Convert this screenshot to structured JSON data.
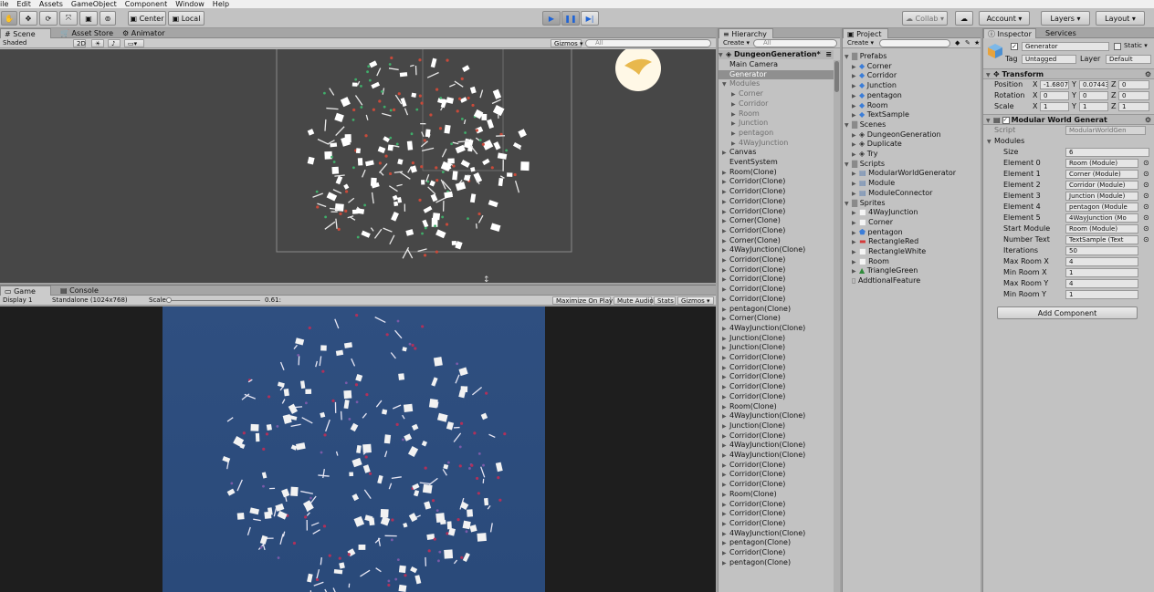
{
  "menu": [
    "ile",
    "Edit",
    "Assets",
    "GameObject",
    "Component",
    "Window",
    "Help"
  ],
  "toolbar": {
    "pivot_label": "Center",
    "space_label": "Local",
    "collab_label": "Collab ▾",
    "account_label": "Account ▾",
    "layers_label": "Layers ▾",
    "layout_label": "Layout ▾"
  },
  "scene_panel": {
    "tabs": [
      "Scene",
      "Asset Store",
      "Animator"
    ],
    "shading": "Shaded",
    "mode_2d": "2D",
    "gizmos": "Gizmos ▾",
    "search_placeholder": "All"
  },
  "game_panel": {
    "tabs": [
      "Game",
      "Console"
    ],
    "display": "Display 1",
    "resolution": "Standalone (1024x768)",
    "scale_label": "Scale",
    "scale_value": "0.61:",
    "scale_fraction": 0.0,
    "maximize": "Maximize On Play",
    "mute": "Mute Audio",
    "stats": "Stats",
    "gizmos": "Gizmos ▾"
  },
  "hierarchy": {
    "tab": "Hierarchy",
    "create": "Create ▾",
    "search_placeholder": "All",
    "scene_name": "DungeonGeneration*",
    "items": [
      {
        "label": "Main Camera",
        "indent": 1,
        "selected": false,
        "dim": false,
        "arrow": ""
      },
      {
        "label": "Generator",
        "indent": 1,
        "selected": true,
        "dim": false,
        "arrow": ""
      },
      {
        "label": "Modules",
        "indent": 1,
        "selected": false,
        "dim": true,
        "arrow": "▼"
      },
      {
        "label": "Corner",
        "indent": 2,
        "selected": false,
        "dim": true,
        "arrow": "▶"
      },
      {
        "label": "Corridor",
        "indent": 2,
        "selected": false,
        "dim": true,
        "arrow": "▶"
      },
      {
        "label": "Room",
        "indent": 2,
        "selected": false,
        "dim": true,
        "arrow": "▶"
      },
      {
        "label": "Junction",
        "indent": 2,
        "selected": false,
        "dim": true,
        "arrow": "▶"
      },
      {
        "label": "pentagon",
        "indent": 2,
        "selected": false,
        "dim": true,
        "arrow": "▶"
      },
      {
        "label": "4WayJunction",
        "indent": 2,
        "selected": false,
        "dim": true,
        "arrow": "▶"
      },
      {
        "label": "Canvas",
        "indent": 1,
        "selected": false,
        "dim": false,
        "arrow": "▶"
      },
      {
        "label": "EventSystem",
        "indent": 1,
        "selected": false,
        "dim": false,
        "arrow": ""
      },
      {
        "label": "Room(Clone)",
        "indent": 1,
        "selected": false,
        "dim": false,
        "arrow": "▶"
      },
      {
        "label": "Corridor(Clone)",
        "indent": 1,
        "selected": false,
        "dim": false,
        "arrow": "▶"
      },
      {
        "label": "Corridor(Clone)",
        "indent": 1,
        "selected": false,
        "dim": false,
        "arrow": "▶"
      },
      {
        "label": "Corridor(Clone)",
        "indent": 1,
        "selected": false,
        "dim": false,
        "arrow": "▶"
      },
      {
        "label": "Corridor(Clone)",
        "indent": 1,
        "selected": false,
        "dim": false,
        "arrow": "▶"
      },
      {
        "label": "Corner(Clone)",
        "indent": 1,
        "selected": false,
        "dim": false,
        "arrow": "▶"
      },
      {
        "label": "Corridor(Clone)",
        "indent": 1,
        "selected": false,
        "dim": false,
        "arrow": "▶"
      },
      {
        "label": "Corner(Clone)",
        "indent": 1,
        "selected": false,
        "dim": false,
        "arrow": "▶"
      },
      {
        "label": "4WayJunction(Clone)",
        "indent": 1,
        "selected": false,
        "dim": false,
        "arrow": "▶"
      },
      {
        "label": "Corridor(Clone)",
        "indent": 1,
        "selected": false,
        "dim": false,
        "arrow": "▶"
      },
      {
        "label": "Corridor(Clone)",
        "indent": 1,
        "selected": false,
        "dim": false,
        "arrow": "▶"
      },
      {
        "label": "Corridor(Clone)",
        "indent": 1,
        "selected": false,
        "dim": false,
        "arrow": "▶"
      },
      {
        "label": "Corridor(Clone)",
        "indent": 1,
        "selected": false,
        "dim": false,
        "arrow": "▶"
      },
      {
        "label": "Corridor(Clone)",
        "indent": 1,
        "selected": false,
        "dim": false,
        "arrow": "▶"
      },
      {
        "label": "pentagon(Clone)",
        "indent": 1,
        "selected": false,
        "dim": false,
        "arrow": "▶"
      },
      {
        "label": "Corner(Clone)",
        "indent": 1,
        "selected": false,
        "dim": false,
        "arrow": "▶"
      },
      {
        "label": "4WayJunction(Clone)",
        "indent": 1,
        "selected": false,
        "dim": false,
        "arrow": "▶"
      },
      {
        "label": "Junction(Clone)",
        "indent": 1,
        "selected": false,
        "dim": false,
        "arrow": "▶"
      },
      {
        "label": "Junction(Clone)",
        "indent": 1,
        "selected": false,
        "dim": false,
        "arrow": "▶"
      },
      {
        "label": "Corridor(Clone)",
        "indent": 1,
        "selected": false,
        "dim": false,
        "arrow": "▶"
      },
      {
        "label": "Corridor(Clone)",
        "indent": 1,
        "selected": false,
        "dim": false,
        "arrow": "▶"
      },
      {
        "label": "Corridor(Clone)",
        "indent": 1,
        "selected": false,
        "dim": false,
        "arrow": "▶"
      },
      {
        "label": "Corridor(Clone)",
        "indent": 1,
        "selected": false,
        "dim": false,
        "arrow": "▶"
      },
      {
        "label": "Corridor(Clone)",
        "indent": 1,
        "selected": false,
        "dim": false,
        "arrow": "▶"
      },
      {
        "label": "Room(Clone)",
        "indent": 1,
        "selected": false,
        "dim": false,
        "arrow": "▶"
      },
      {
        "label": "4WayJunction(Clone)",
        "indent": 1,
        "selected": false,
        "dim": false,
        "arrow": "▶"
      },
      {
        "label": "Junction(Clone)",
        "indent": 1,
        "selected": false,
        "dim": false,
        "arrow": "▶"
      },
      {
        "label": "Corridor(Clone)",
        "indent": 1,
        "selected": false,
        "dim": false,
        "arrow": "▶"
      },
      {
        "label": "4WayJunction(Clone)",
        "indent": 1,
        "selected": false,
        "dim": false,
        "arrow": "▶"
      },
      {
        "label": "4WayJunction(Clone)",
        "indent": 1,
        "selected": false,
        "dim": false,
        "arrow": "▶"
      },
      {
        "label": "Corridor(Clone)",
        "indent": 1,
        "selected": false,
        "dim": false,
        "arrow": "▶"
      },
      {
        "label": "Corridor(Clone)",
        "indent": 1,
        "selected": false,
        "dim": false,
        "arrow": "▶"
      },
      {
        "label": "Corridor(Clone)",
        "indent": 1,
        "selected": false,
        "dim": false,
        "arrow": "▶"
      },
      {
        "label": "Room(Clone)",
        "indent": 1,
        "selected": false,
        "dim": false,
        "arrow": "▶"
      },
      {
        "label": "Corridor(Clone)",
        "indent": 1,
        "selected": false,
        "dim": false,
        "arrow": "▶"
      },
      {
        "label": "Corridor(Clone)",
        "indent": 1,
        "selected": false,
        "dim": false,
        "arrow": "▶"
      },
      {
        "label": "Corridor(Clone)",
        "indent": 1,
        "selected": false,
        "dim": false,
        "arrow": "▶"
      },
      {
        "label": "4WayJunction(Clone)",
        "indent": 1,
        "selected": false,
        "dim": false,
        "arrow": "▶"
      },
      {
        "label": "pentagon(Clone)",
        "indent": 1,
        "selected": false,
        "dim": false,
        "arrow": "▶"
      },
      {
        "label": "Corridor(Clone)",
        "indent": 1,
        "selected": false,
        "dim": false,
        "arrow": "▶"
      },
      {
        "label": "pentagon(Clone)",
        "indent": 1,
        "selected": false,
        "dim": false,
        "arrow": "▶"
      }
    ]
  },
  "project": {
    "tab": "Project",
    "create": "Create ▾",
    "items": [
      {
        "label": "Prefabs",
        "indent": 0,
        "kind": "folder"
      },
      {
        "label": "Corner",
        "indent": 1,
        "kind": "prefab"
      },
      {
        "label": "Corridor",
        "indent": 1,
        "kind": "prefab"
      },
      {
        "label": "Junction",
        "indent": 1,
        "kind": "prefab"
      },
      {
        "label": "pentagon",
        "indent": 1,
        "kind": "prefab"
      },
      {
        "label": "Room",
        "indent": 1,
        "kind": "prefab"
      },
      {
        "label": "TextSample",
        "indent": 1,
        "kind": "prefab"
      },
      {
        "label": "Scenes",
        "indent": 0,
        "kind": "folder"
      },
      {
        "label": "DungeonGeneration",
        "indent": 1,
        "kind": "scene"
      },
      {
        "label": "Duplicate",
        "indent": 1,
        "kind": "scene"
      },
      {
        "label": "Try",
        "indent": 1,
        "kind": "scene"
      },
      {
        "label": "Scripts",
        "indent": 0,
        "kind": "folder"
      },
      {
        "label": "ModularWorldGenerator",
        "indent": 1,
        "kind": "script"
      },
      {
        "label": "Module",
        "indent": 1,
        "kind": "script"
      },
      {
        "label": "ModuleConnector",
        "indent": 1,
        "kind": "script"
      },
      {
        "label": "Sprites",
        "indent": 0,
        "kind": "folder"
      },
      {
        "label": "4WayJunction",
        "indent": 1,
        "kind": "sprite-white"
      },
      {
        "label": "Corner",
        "indent": 1,
        "kind": "sprite-white"
      },
      {
        "label": "pentagon",
        "indent": 1,
        "kind": "sprite-blue"
      },
      {
        "label": "RectangleRed",
        "indent": 1,
        "kind": "sprite-red"
      },
      {
        "label": "RectangleWhite",
        "indent": 1,
        "kind": "sprite-white"
      },
      {
        "label": "Room",
        "indent": 1,
        "kind": "sprite-white"
      },
      {
        "label": "TriangleGreen",
        "indent": 1,
        "kind": "sprite-green"
      },
      {
        "label": "AddtionalFeature",
        "indent": 0,
        "kind": "file"
      }
    ]
  },
  "inspector": {
    "tabs": [
      "Inspector",
      "Services"
    ],
    "object_name": "Generator",
    "static_label": "Static ▾",
    "tag_label": "Tag",
    "tag_value": "Untagged",
    "layer_label": "Layer",
    "layer_value": "Default",
    "transform": {
      "title": "Transform",
      "position_label": "Position",
      "pos_x": "-1.6807",
      "pos_y": "0.07443",
      "pos_z": "0",
      "rotation_label": "Rotation",
      "rot_x": "0",
      "rot_y": "0",
      "rot_z": "0",
      "scale_label": "Scale",
      "scl_x": "1",
      "scl_y": "1",
      "scl_z": "1"
    },
    "component": {
      "title": "Modular World Generat",
      "script_label": "Script",
      "script_value": "ModularWorldGen",
      "modules_label": "Modules",
      "size_label": "Size",
      "size_value": "6",
      "elements": [
        {
          "label": "Element 0",
          "value": "Room (Module)"
        },
        {
          "label": "Element 1",
          "value": "Corner (Module)"
        },
        {
          "label": "Element 2",
          "value": "Corridor (Module)"
        },
        {
          "label": "Element 3",
          "value": "Junction (Module)"
        },
        {
          "label": "Element 4",
          "value": "pentagon (Module"
        },
        {
          "label": "Element 5",
          "value": "4WayJunction (Mo"
        }
      ],
      "fields": [
        {
          "label": "Start Module",
          "value": "Room (Module)"
        },
        {
          "label": "Number Text",
          "value": "TextSample (Text"
        },
        {
          "label": "Iterations",
          "value": "50"
        },
        {
          "label": "Max Room X",
          "value": "4"
        },
        {
          "label": "Min Room X",
          "value": "1"
        },
        {
          "label": "Max Room Y",
          "value": "4"
        },
        {
          "label": "Min Room Y",
          "value": "1"
        }
      ]
    },
    "add_component": "Add Component"
  },
  "colors": {
    "scene_bg": "#474747",
    "game_bg": "#2d4c7c",
    "selection": "#8f8f8f",
    "play_accent": "#1f64d6"
  }
}
